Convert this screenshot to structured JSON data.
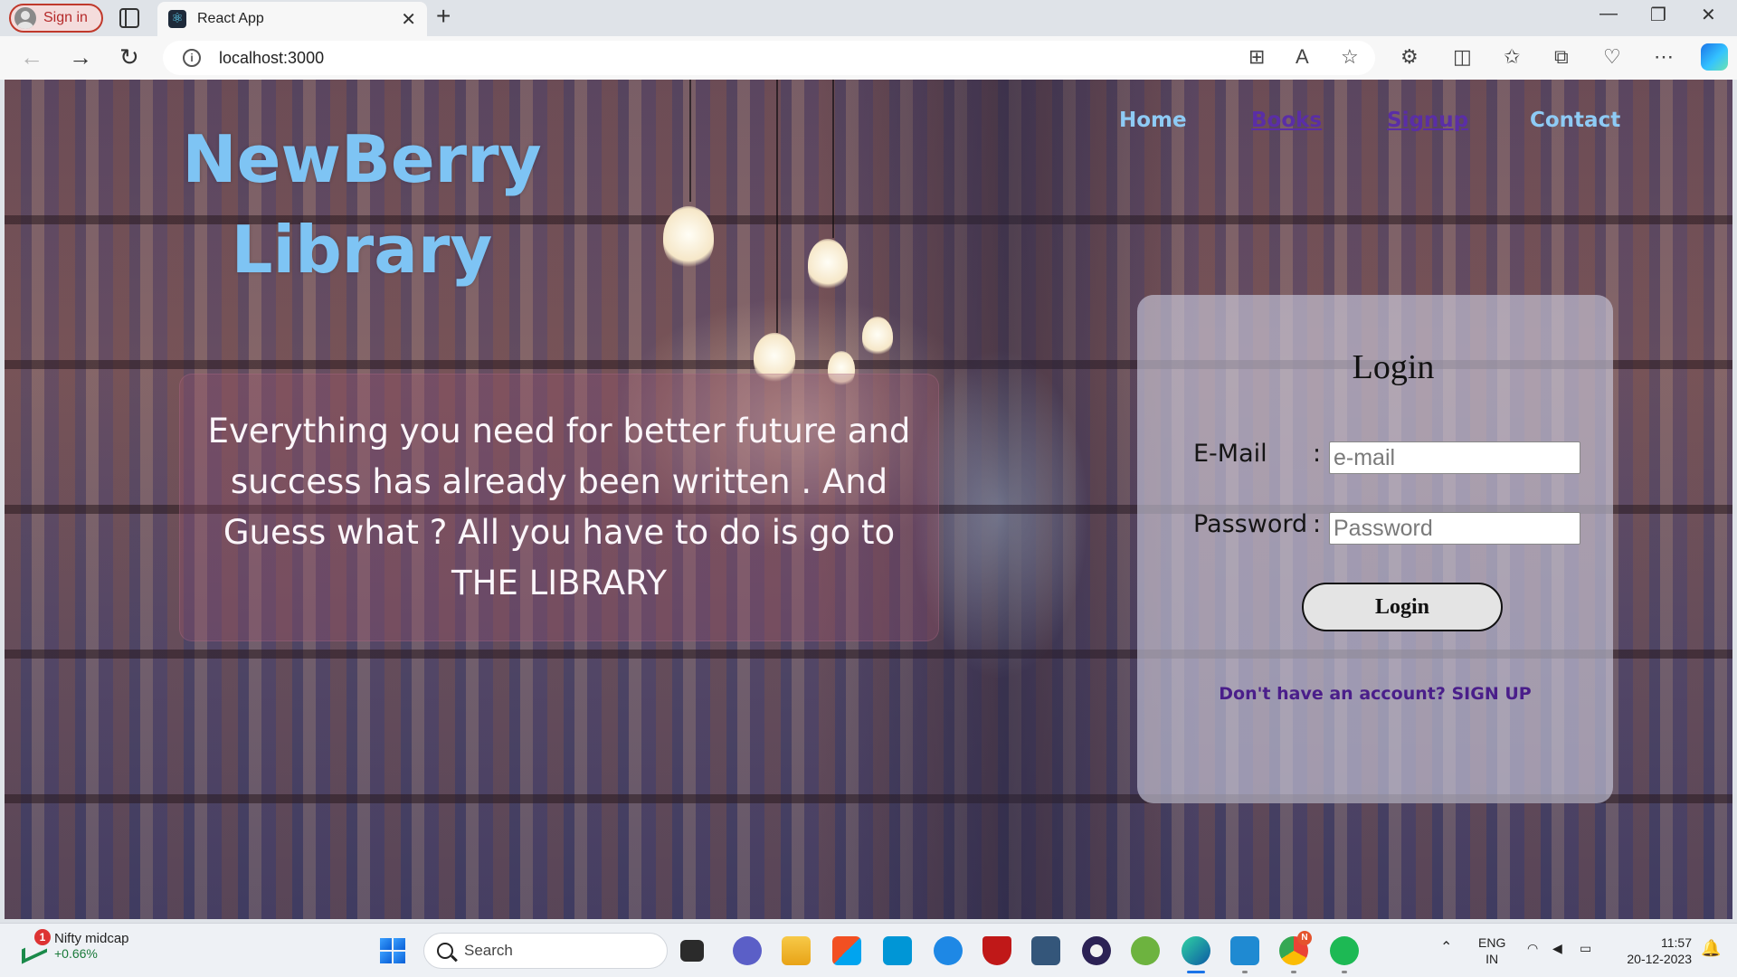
{
  "browser": {
    "profile_label": "Sign in",
    "tab_title": "React App",
    "url": "localhost:3000"
  },
  "page": {
    "brand": "NewBerry Library",
    "nav": {
      "home": "Home",
      "books": "Books",
      "signup": "Signup",
      "contact": "Contact"
    },
    "quote": "Everything you need for better future and success has already been written . And Guess what ? All you have to do is go to THE LIBRARY",
    "login": {
      "title": "Login",
      "email_label": "E-Mail",
      "email_placeholder": "e-mail",
      "password_label": "Password",
      "password_placeholder": "Password",
      "colon": ":",
      "button": "Login",
      "signup_prompt": "Don't have an account? SIGN UP"
    },
    "colors": {
      "brand": "#7ec4f4",
      "nav_visited": "#5a2ea6",
      "signup_link": "#4a1e8a"
    }
  },
  "taskbar": {
    "widget_title": "Nifty midcap",
    "widget_value": "+0.66%",
    "widget_badge": "1",
    "search_label": "Search",
    "language_line1": "ENG",
    "language_line2": "IN",
    "time": "11:57",
    "date": "20-12-2023",
    "chrome_badge": "N",
    "apps": [
      "file-explorer-icon",
      "teams-icon",
      "folder-icon",
      "store-icon",
      "myhp-icon",
      "mail-icon",
      "mcafee-icon",
      "network-icon",
      "eclipse-icon",
      "spring-icon",
      "edge-icon",
      "vscode-icon",
      "chrome-icon",
      "spotify-icon"
    ]
  }
}
